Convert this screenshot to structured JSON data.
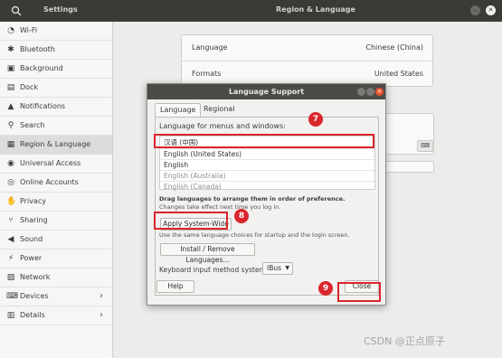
{
  "window": {
    "title": "Settings",
    "panel_title": "Region & Language"
  },
  "sidebar": {
    "items": [
      {
        "icon": "wifi-icon",
        "glyph": "◔",
        "label": "Wi-Fi"
      },
      {
        "icon": "bluetooth-icon",
        "glyph": "✱",
        "label": "Bluetooth"
      },
      {
        "icon": "background-icon",
        "glyph": "▣",
        "label": "Background"
      },
      {
        "icon": "dock-icon",
        "glyph": "▤",
        "label": "Dock"
      },
      {
        "icon": "bell-icon",
        "glyph": "▲",
        "label": "Notifications"
      },
      {
        "icon": "search-icon",
        "glyph": "⚲",
        "label": "Search"
      },
      {
        "icon": "region-icon",
        "glyph": "▦",
        "label": "Region & Language"
      },
      {
        "icon": "accessibility-icon",
        "glyph": "◉",
        "label": "Universal Access"
      },
      {
        "icon": "online-accounts-icon",
        "glyph": "◎",
        "label": "Online Accounts"
      },
      {
        "icon": "privacy-icon",
        "glyph": "✋",
        "label": "Privacy"
      },
      {
        "icon": "share-icon",
        "glyph": "⑂",
        "label": "Sharing"
      },
      {
        "icon": "sound-icon",
        "glyph": "◀",
        "label": "Sound"
      },
      {
        "icon": "power-icon",
        "glyph": "⚡",
        "label": "Power"
      },
      {
        "icon": "network-icon",
        "glyph": "▨",
        "label": "Network"
      },
      {
        "icon": "devices-icon",
        "glyph": "⌨",
        "label": "Devices",
        "chevron": "›"
      },
      {
        "icon": "details-icon",
        "glyph": "▥",
        "label": "Details",
        "chevron": "›"
      }
    ],
    "active_index": 6
  },
  "main": {
    "language_label": "Language",
    "language_value": "Chinese (China)",
    "formats_label": "Formats",
    "formats_value": "United States"
  },
  "dialog": {
    "title": "Language Support",
    "tabs": [
      "Language",
      "Regional Formats"
    ],
    "lang_menu_label": "Language for menus and windows:",
    "languages": [
      "汉语 (中国)",
      "English (United States)",
      "English",
      "English (Australia)",
      "English (Canada)"
    ],
    "drag_hint": "Drag languages to arrange them in order of preference.",
    "drag_hint2": "Changes take effect next time you log in.",
    "apply_button": "Apply System-Wide",
    "apply_hint": "Use the same language choices for startup and the login screen.",
    "install_button": "Install / Remove Languages...",
    "keyboard_label": "Keyboard input method system:",
    "keyboard_value": "IBus",
    "help_button": "Help",
    "close_button": "Close"
  },
  "annotations": {
    "m7": "7",
    "m8": "8",
    "m9": "9",
    "color": "#d9262c"
  },
  "watermark": "CSDN @正点原子"
}
